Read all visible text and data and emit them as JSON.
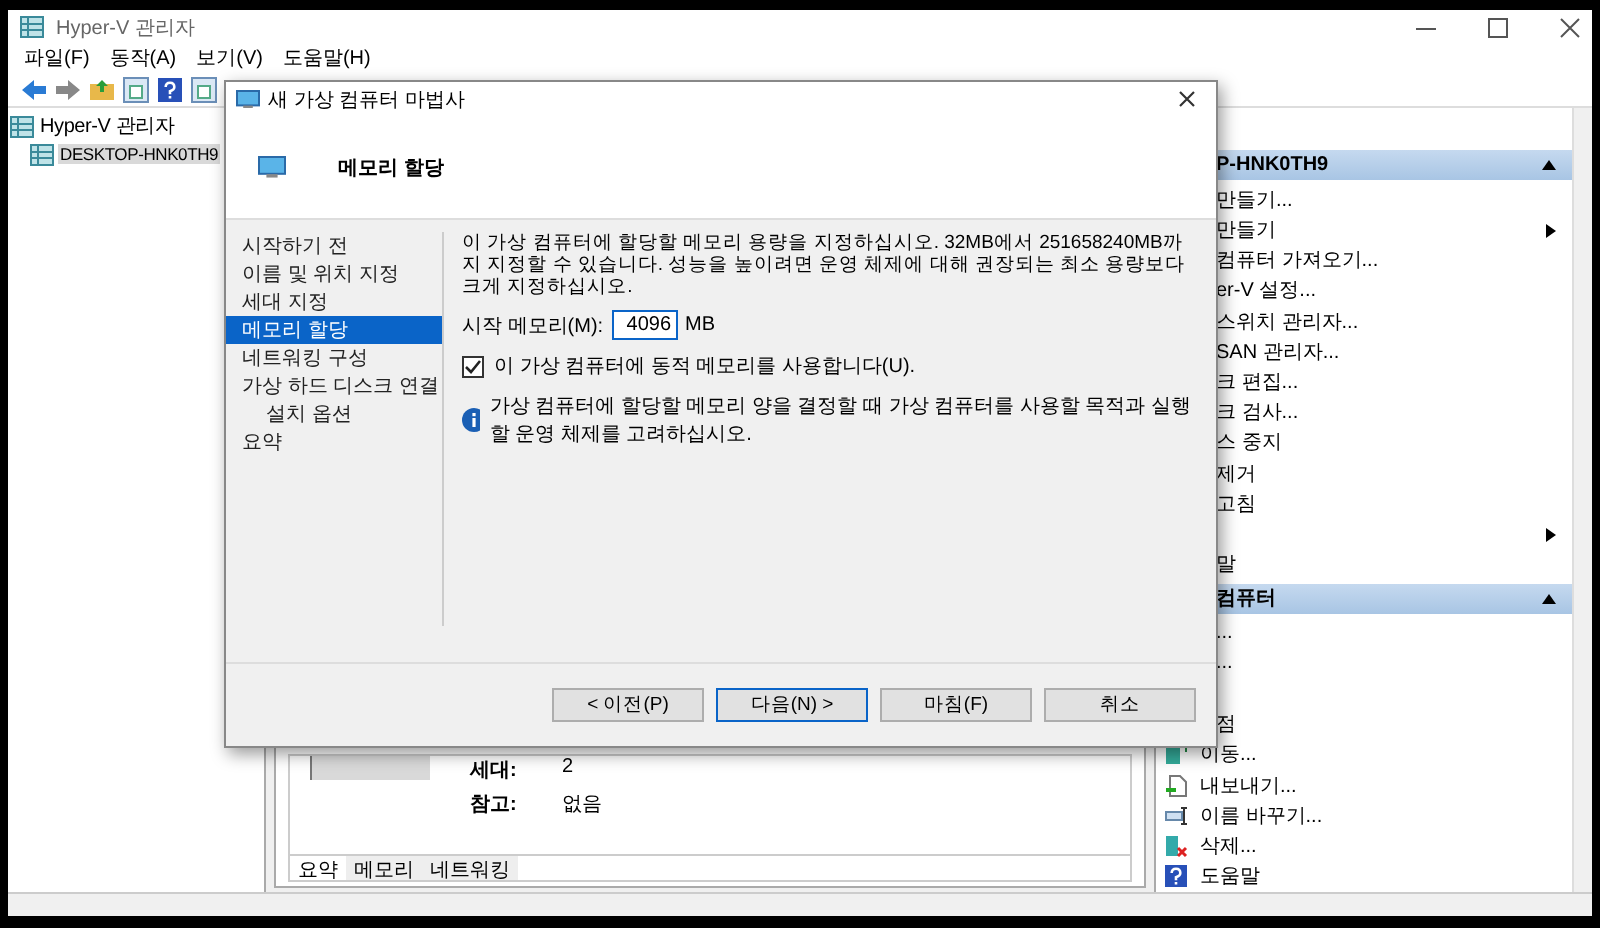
{
  "window": {
    "title": "Hyper-V 관리자"
  },
  "menu": [
    "파일(F)",
    "동작(A)",
    "보기(V)",
    "도움말(H)"
  ],
  "toolbar": [
    {
      "kind": "back"
    },
    {
      "kind": "forward"
    },
    {
      "kind": "folder"
    },
    {
      "kind": "pane"
    },
    {
      "kind": "help"
    },
    {
      "kind": "pane"
    }
  ],
  "tree": [
    {
      "label": "Hyper-V 관리자",
      "selected": false,
      "children": [
        {
          "label": "DESKTOP-HNK0TH9",
          "selected": true
        }
      ]
    }
  ],
  "details": {
    "rows": [
      {
        "label": "세대:",
        "value": "2"
      },
      {
        "label": "참고:",
        "value": "없음"
      }
    ],
    "tabs": [
      {
        "label": "요약",
        "selected": true
      },
      {
        "label": "메모리",
        "selected": false
      },
      {
        "label": "네트워킹",
        "selected": false
      }
    ]
  },
  "actions": [
    {
      "kind": "header",
      "label": "P-HNK0TH9"
    },
    {
      "kind": "partial",
      "label": "만들기..."
    },
    {
      "kind": "partial",
      "label": "만들기",
      "submenu": true
    },
    {
      "kind": "partial",
      "label": "컴퓨터 가져오기..."
    },
    {
      "kind": "partial",
      "label": "er-V 설정..."
    },
    {
      "kind": "partial",
      "label": "스위치 관리자..."
    },
    {
      "kind": "partial",
      "label": "SAN 관리자..."
    },
    {
      "kind": "partial",
      "label": "크 편집..."
    },
    {
      "kind": "partial",
      "label": "크 검사..."
    },
    {
      "kind": "partial",
      "label": "스 중지"
    },
    {
      "kind": "partial",
      "label": "제거"
    },
    {
      "kind": "partial",
      "label": "고침"
    },
    {
      "kind": "partial",
      "submenu": true
    },
    {
      "kind": "partial",
      "label": "말"
    },
    {
      "kind": "header",
      "label": "컴퓨터"
    },
    {
      "kind": "partial",
      "label": "..."
    },
    {
      "kind": "partial",
      "label": "..."
    },
    {
      "kind": "partial"
    },
    {
      "kind": "partial",
      "label": "점"
    },
    {
      "kind": "full",
      "label": "이동..."
    },
    {
      "kind": "full",
      "label": "내보내기..."
    },
    {
      "kind": "full",
      "label": "이름 바꾸기..."
    },
    {
      "kind": "full",
      "label": "삭제..."
    },
    {
      "kind": "full",
      "label": "도움말"
    }
  ],
  "dialog": {
    "title": "새 가상 컴퓨터 마법사",
    "heading": "메모리 할당",
    "steps": [
      {
        "label": "시작하기 전",
        "selected": false
      },
      {
        "label": "이름 및 위치 지정",
        "selected": false
      },
      {
        "label": "세대 지정",
        "selected": false
      },
      {
        "label": "메모리 할당",
        "selected": true
      },
      {
        "label": "네트워킹 구성",
        "selected": false
      },
      {
        "label": "가상 하드 디스크 연결",
        "selected": false,
        "children": [
          {
            "label": "설치 옵션",
            "selected": false
          }
        ]
      },
      {
        "label": "요약",
        "selected": false
      }
    ],
    "description": "이 가상 컴퓨터에 할당할 메모리 용량을 지정하십시오. 32MB에서 251658240MB까지 지정할 수 있습니다. 성능을 높이려면 운영 체제에 대해 권장되는 최소 용량보다 크게 지정하십시오.",
    "memory_label": "시작 메모리(M):",
    "memory_value": "4096",
    "memory_unit": "MB",
    "dynamic_memory": {
      "label": "이 가상 컴퓨터에 동적 메모리를 사용합니다(U).",
      "checked": true
    },
    "info": "가상 컴퓨터에 할당할 메모리 양을 결정할 때 가상 컴퓨터를 사용할 목적과 실행할 운영 체제를 고려하십시오.",
    "buttons": [
      {
        "label": "< 이전(P)",
        "default": false
      },
      {
        "label": "다음(N) >",
        "default": true
      },
      {
        "label": "마침(F)",
        "default": false
      },
      {
        "label": "취소",
        "default": false
      }
    ]
  }
}
